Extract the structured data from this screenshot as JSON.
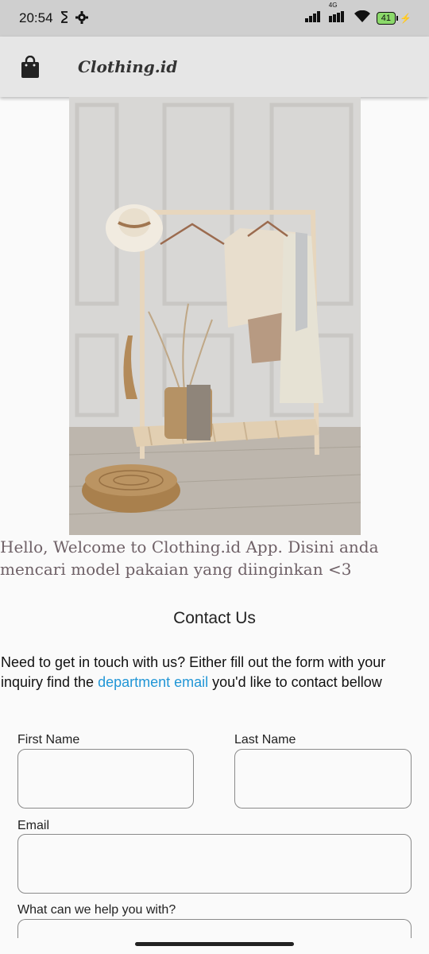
{
  "status_bar": {
    "time": "20:54",
    "network": "4G",
    "battery": "41"
  },
  "app_bar": {
    "title": "Clothing.id",
    "icon": "shopping-bag-icon"
  },
  "hero": {
    "icon": "clothing-rack-photo"
  },
  "welcome_text": "Hello, Welcome to Clothing.id App. Disini anda mencari model pakaian yang diinginkan <3",
  "contact": {
    "title": "Contact Us",
    "desc_before": "Need to get in touch with us? Either fill out the form with your inquiry find the ",
    "desc_link": "department email",
    "desc_after": " you'd like to contact bellow"
  },
  "form": {
    "first_name_label": "First Name",
    "last_name_label": "Last Name",
    "email_label": "Email",
    "help_label": "What can we help you with?"
  },
  "colors": {
    "link": "#2196d6",
    "appbar": "#e6e6e6",
    "statusbar": "#cfcfcf"
  }
}
